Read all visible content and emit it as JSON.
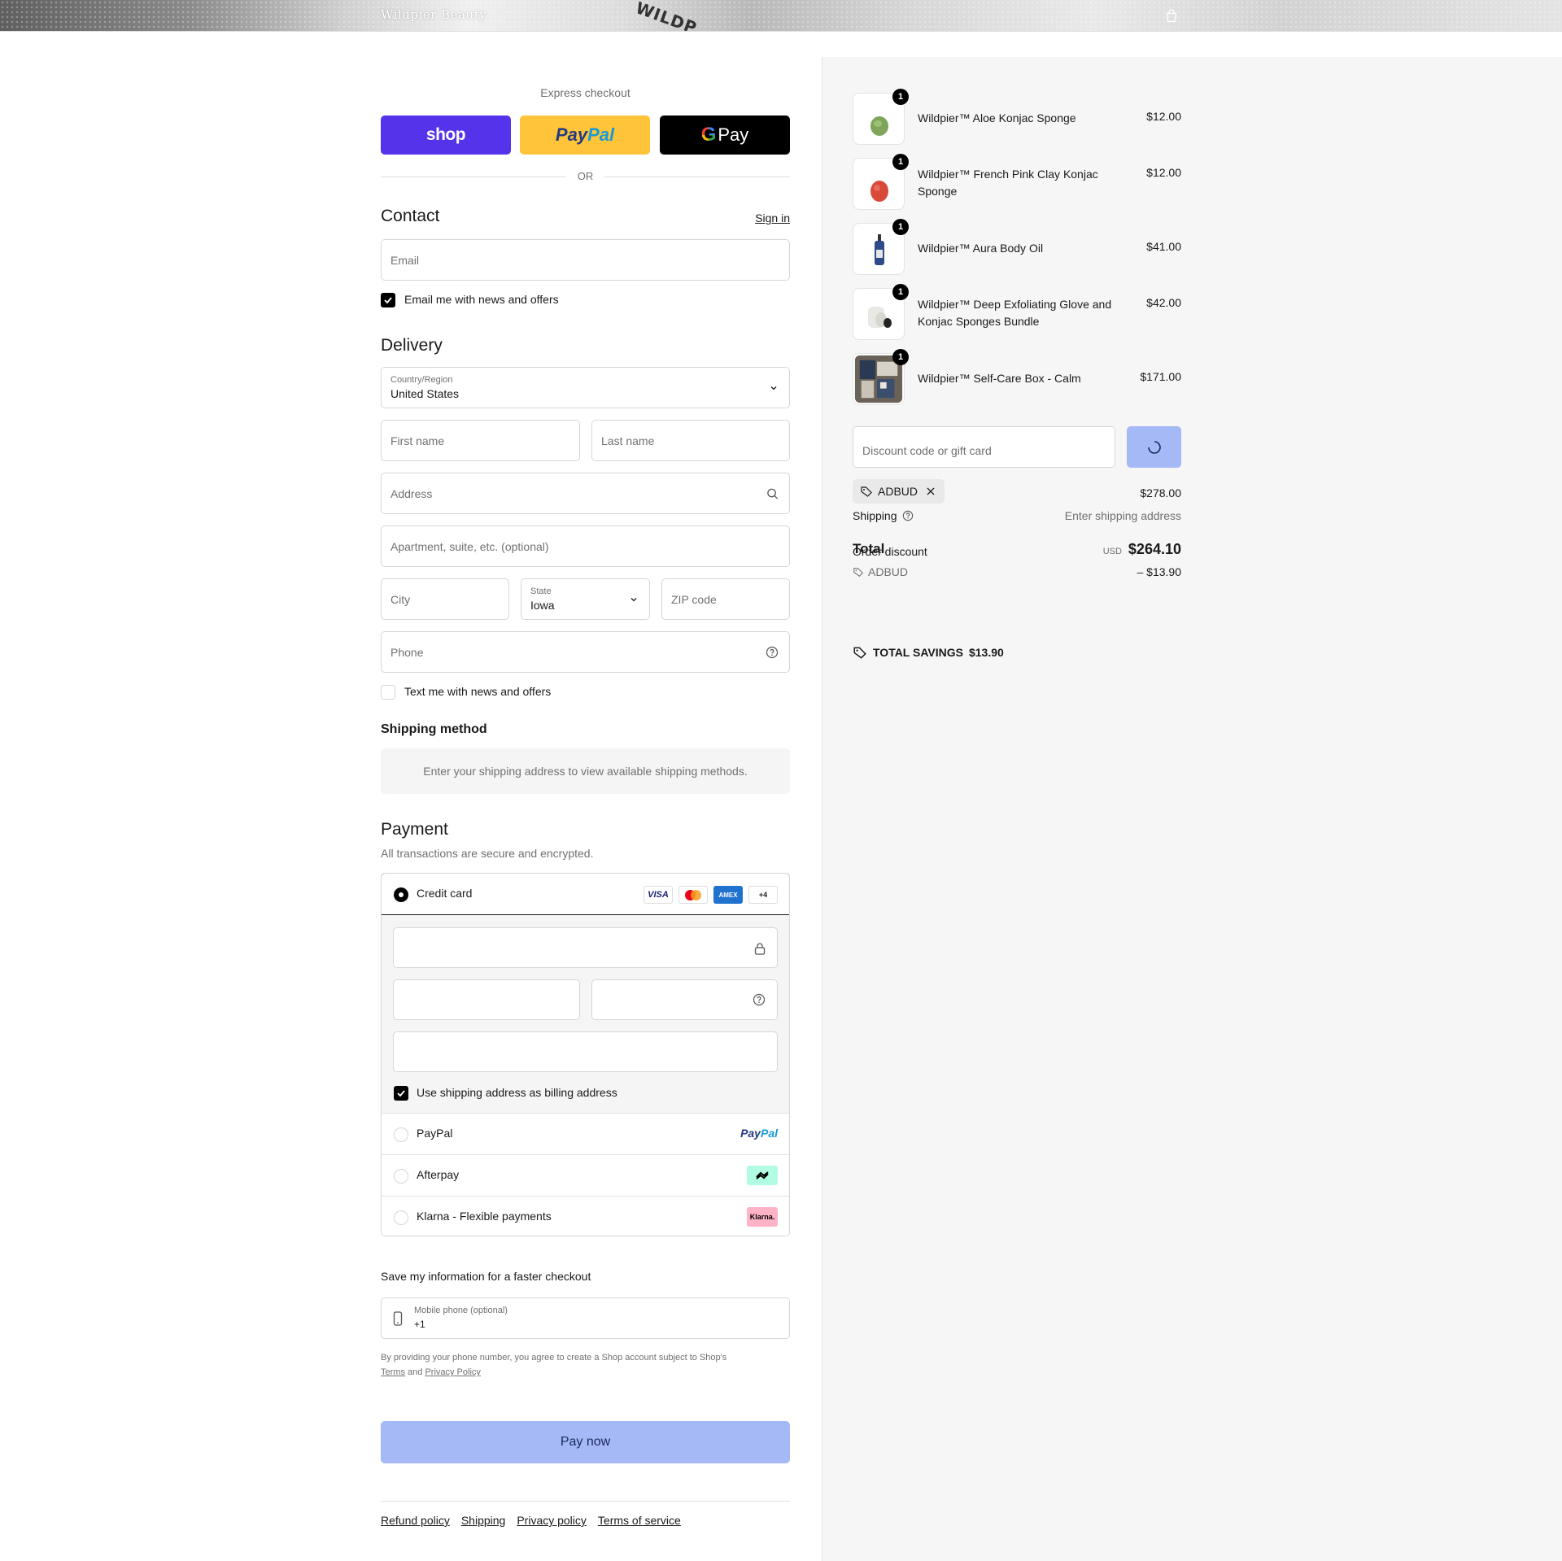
{
  "header": {
    "brand": "Wildpier Beauty",
    "banner_stamp": "WILDP"
  },
  "express": {
    "label": "Express checkout",
    "shop_label": "shop",
    "paypal_part1": "Pay",
    "paypal_part2": "Pal",
    "gpay_label": "Pay",
    "or_label": "OR"
  },
  "contact": {
    "title": "Contact",
    "sign_in": "Sign in",
    "email_placeholder": "Email",
    "newsletter_label": "Email me with news and offers",
    "newsletter_checked": true
  },
  "delivery": {
    "title": "Delivery",
    "country_label": "Country/Region",
    "country_value": "United States",
    "first_name_placeholder": "First name",
    "last_name_placeholder": "Last name",
    "address_placeholder": "Address",
    "apartment_placeholder": "Apartment, suite, etc. (optional)",
    "city_placeholder": "City",
    "state_label": "State",
    "state_value": "Iowa",
    "zip_placeholder": "ZIP code",
    "phone_placeholder": "Phone",
    "text_offers_label": "Text me with news and offers",
    "text_offers_checked": false
  },
  "shipping_method": {
    "title": "Shipping method",
    "message": "Enter your shipping address to view available shipping methods."
  },
  "payment": {
    "title": "Payment",
    "subtitle": "All transactions are secure and encrypted.",
    "credit_card_label": "Credit card",
    "card_brands": [
      "VISA",
      "AMEX",
      "+4"
    ],
    "billing_same_label": "Use shipping address as billing address",
    "billing_same_checked": true,
    "paypal_label": "PayPal",
    "paypal_logo_1": "Pay",
    "paypal_logo_2": "Pal",
    "afterpay_label": "Afterpay",
    "klarna_label": "Klarna - Flexible payments",
    "klarna_logo": "Klarna."
  },
  "save_info": {
    "title": "Save my information for a faster checkout",
    "mobile_label": "Mobile phone (optional)",
    "mobile_value": "+1",
    "disclaimer": "By providing your phone number, you agree to create a Shop account subject to Shop's",
    "terms": "Terms",
    "and": "and",
    "privacy": "Privacy Policy"
  },
  "pay_now": "Pay now",
  "footer_links": [
    "Refund policy",
    "Shipping",
    "Privacy policy",
    "Terms of service"
  ],
  "order": {
    "items": [
      {
        "name": "Wildpier™ Aloe Konjac Sponge",
        "price": "$12.00",
        "qty": "1"
      },
      {
        "name": "Wildpier™ French Pink Clay Konjac Sponge",
        "price": "$12.00",
        "qty": "1"
      },
      {
        "name": "Wildpier™ Aura Body Oil",
        "price": "$41.00",
        "qty": "1"
      },
      {
        "name": "Wildpier™ Deep Exfoliating Glove and Konjac Sponges Bundle",
        "price": "$42.00",
        "qty": "1"
      },
      {
        "name": "Wildpier™ Self-Care Box - Calm",
        "price": "$171.00",
        "qty": "1"
      }
    ],
    "discount_placeholder": "Discount code or gift card",
    "applied_code": "ADBUD",
    "subtotal_value": "$278.00",
    "shipping_label": "Shipping",
    "shipping_value": "Enter shipping address",
    "total_label": "Total",
    "overlap_label": "Order discount",
    "currency": "USD",
    "total_value": "$264.10",
    "discount_code": "ADBUD",
    "discount_value": "– $13.90",
    "savings_label": "TOTAL SAVINGS",
    "savings_value": "$13.90"
  },
  "colors": {
    "shop": "#5433eb",
    "paypal": "#ffc439",
    "pay_now": "#a6b9f7",
    "apply_button": "#a6b9f7"
  }
}
